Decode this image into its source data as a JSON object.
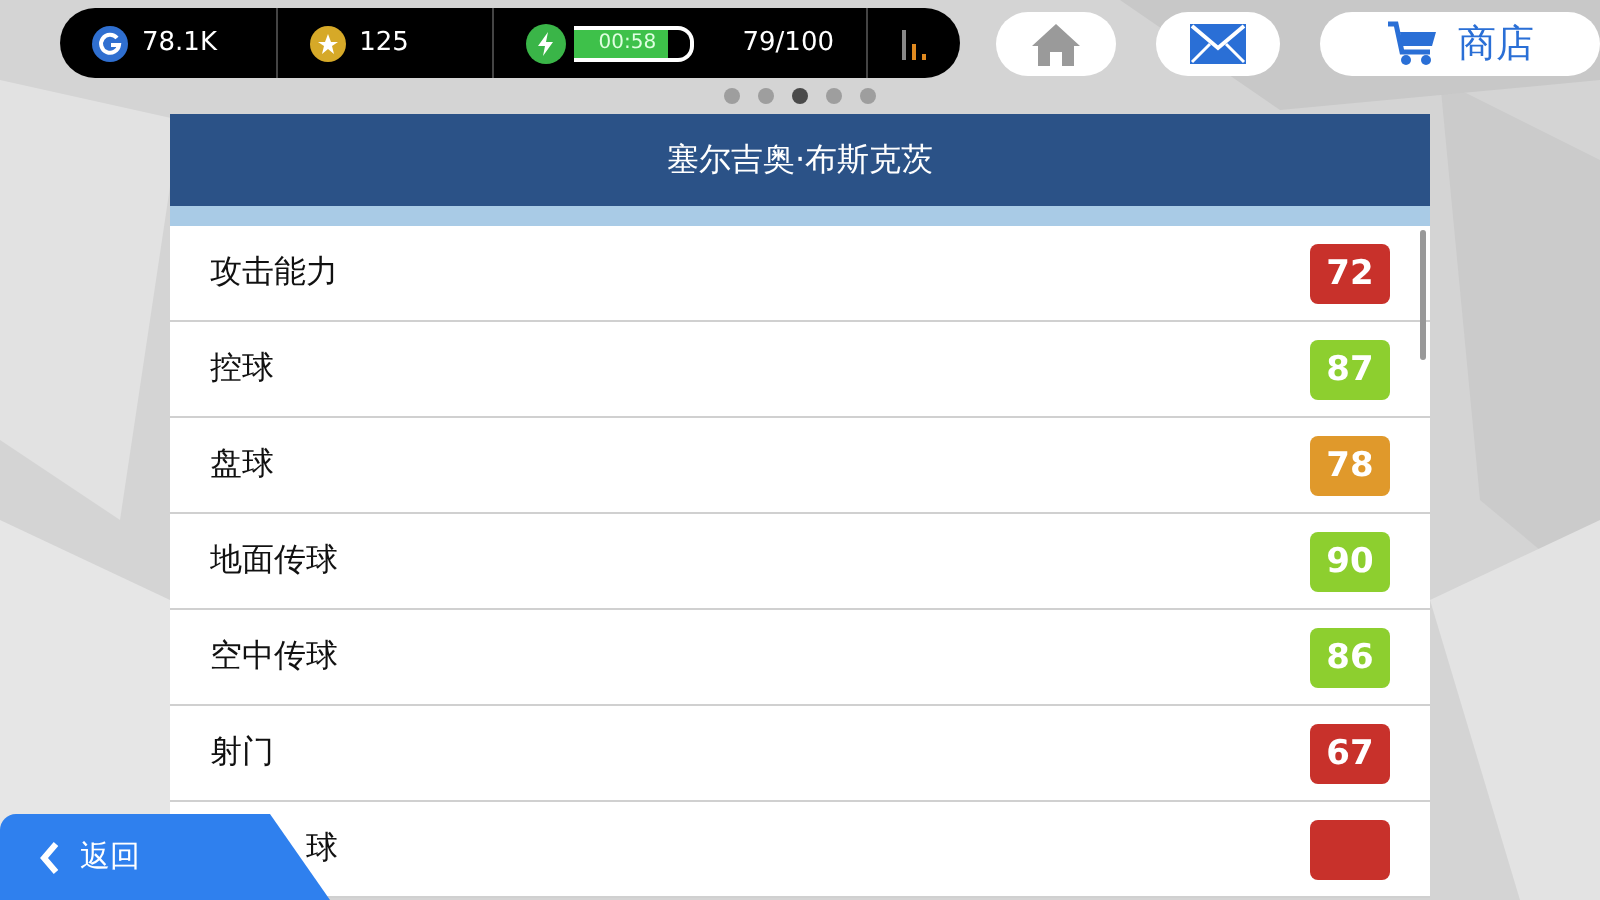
{
  "top_bar": {
    "gold": "78.1K",
    "coins": "125",
    "energy_bar": {
      "timer": "00:58",
      "level": 0.8
    },
    "energy": "79/100"
  },
  "nav_buttons": [
    {
      "kind": "home"
    },
    {
      "kind": "mail"
    },
    {
      "kind": "shop",
      "label": "商店"
    }
  ],
  "page_dots": [
    {
      "selected": false
    },
    {
      "selected": false
    },
    {
      "selected": true
    },
    {
      "selected": false
    },
    {
      "selected": false
    }
  ],
  "panel": {
    "title": "塞尔吉奥·布斯克茨",
    "rows": [
      {
        "label": "攻击能力",
        "value": "72",
        "color": "#c8312b"
      },
      {
        "label": "控球",
        "value": "87",
        "color": "#8dcf2f"
      },
      {
        "label": "盘球",
        "value": "78",
        "color": "#e0992b"
      },
      {
        "label": "地面传球",
        "value": "90",
        "color": "#8dcf2f"
      },
      {
        "label": "空中传球",
        "value": "86",
        "color": "#8dcf2f"
      },
      {
        "label": "射门",
        "value": "67",
        "color": "#c8312b"
      },
      {
        "label": "球",
        "kind": "partial",
        "color": "#c8312b"
      }
    ]
  },
  "back_button": {
    "label": "返回"
  }
}
